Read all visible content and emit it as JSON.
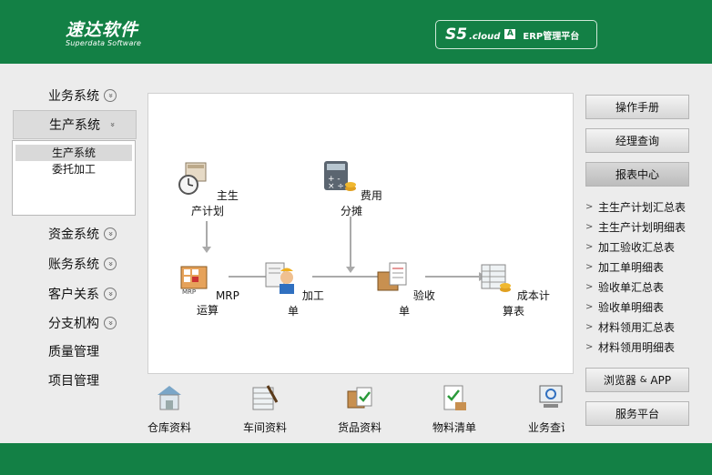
{
  "header": {
    "logo_cn": "速达软件",
    "logo_en": "Superdata Software",
    "product_s5": "S5",
    "product_cloud": ".cloud",
    "product_a": "A",
    "product_erp": "ERP管理平台"
  },
  "sidebar": {
    "items": [
      {
        "label": "业务系统",
        "chevron": true,
        "active": false
      },
      {
        "label": "生产系统",
        "chevron": true,
        "active": true
      },
      {
        "label": "资金系统",
        "chevron": true,
        "active": false
      },
      {
        "label": "账务系统",
        "chevron": true,
        "active": false
      },
      {
        "label": "客户关系",
        "chevron": true,
        "active": false
      },
      {
        "label": "分支机构",
        "chevron": true,
        "active": false
      },
      {
        "label": "质量管理",
        "chevron": false,
        "active": false
      },
      {
        "label": "项目管理",
        "chevron": false,
        "active": false
      }
    ],
    "submenu": [
      {
        "label": "生产系统",
        "selected": true
      },
      {
        "label": "委托加工",
        "selected": false
      }
    ]
  },
  "flow": {
    "nodes": {
      "master_plan": "主生产计划",
      "cost_alloc": "费用分摊",
      "mrp": "MRP运算",
      "work_order": "加工单",
      "inspection": "验收单",
      "cost_sheet": "成本计算表"
    }
  },
  "bottom_icons": [
    {
      "label": "仓库资料",
      "icon": "warehouse-icon"
    },
    {
      "label": "车间资料",
      "icon": "workshop-icon"
    },
    {
      "label": "货品资料",
      "icon": "goods-icon"
    },
    {
      "label": "物料清单",
      "icon": "bom-icon"
    },
    {
      "label": "业务查询",
      "icon": "query-icon"
    }
  ],
  "right": {
    "manual": "操作手册",
    "manager_query": "经理查询",
    "report_center": "报表中心",
    "reports": [
      "主生产计划汇总表",
      "主生产计划明细表",
      "加工验收汇总表",
      "加工单明细表",
      "验收单汇总表",
      "验收单明细表",
      "材料领用汇总表",
      "材料领用明细表"
    ],
    "browser_main": "浏览器",
    "browser_amp": "&",
    "browser_app": "APP",
    "service": "服务平台"
  }
}
